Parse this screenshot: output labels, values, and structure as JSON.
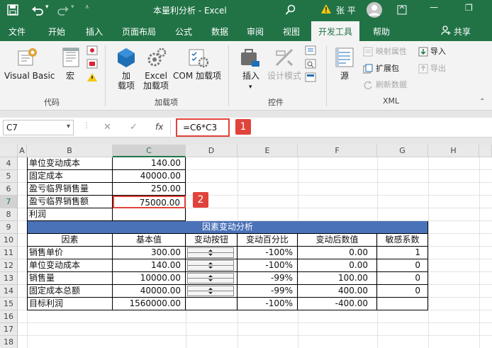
{
  "titlebar": {
    "title": "本量利分析 - Excel",
    "user": "张 平",
    "minimize": "—",
    "restore": "❐"
  },
  "tabs": [
    "文件",
    "开始",
    "插入",
    "页面布局",
    "公式",
    "数据",
    "审阅",
    "视图",
    "开发工具",
    "帮助"
  ],
  "share": "共享",
  "ribbon": {
    "code": {
      "visual_basic": "Visual Basic",
      "macro": "宏",
      "group": "代码"
    },
    "addins": {
      "addin": "加\n载项",
      "excel_addin": "Excel\n加载项",
      "com_addin": "COM 加载项",
      "group": "加载项"
    },
    "controls": {
      "insert": "插入",
      "design_mode": "设计模式",
      "group": "控件"
    },
    "xml": {
      "source": "源",
      "map_props": "映射属性",
      "expand_packs": "扩展包",
      "refresh_data": "刷新数据",
      "import": "导入",
      "export": "导出",
      "group": "XML"
    }
  },
  "formula": {
    "namebox": "C7",
    "cancel": "✕",
    "enter": "✓",
    "fx": "fx",
    "value": "=C6*C3"
  },
  "callouts": [
    "1",
    "2"
  ],
  "columns": [
    "A",
    "B",
    "C",
    "D",
    "E",
    "F",
    "G",
    "H"
  ],
  "rows": [
    "4",
    "5",
    "6",
    "7",
    "8",
    "9",
    "10",
    "11",
    "12",
    "13",
    "14",
    "15",
    "16",
    "17",
    "18"
  ],
  "top_table": [
    {
      "label": "单位变动成本",
      "value": "140.00"
    },
    {
      "label": "固定成本",
      "value": "40000.00"
    },
    {
      "label": "盈亏临界销售量",
      "value": "250.00"
    },
    {
      "label": "盈亏临界销售额",
      "value": "75000.00"
    },
    {
      "label": "利润",
      "value": ""
    }
  ],
  "analysis": {
    "title": "因素变动分析",
    "headers": [
      "因素",
      "基本值",
      "变动按钮",
      "变动百分比",
      "变动后数值",
      "敏感系数"
    ],
    "rows": [
      {
        "factor": "销售单价",
        "base": "300.00",
        "pct": "-100%",
        "after": "0.00",
        "sens": "1"
      },
      {
        "factor": "单位变动成本",
        "base": "140.00",
        "pct": "-100%",
        "after": "0.00",
        "sens": "0"
      },
      {
        "factor": "销售量",
        "base": "10000.00",
        "pct": "-99%",
        "after": "100.00",
        "sens": "0"
      },
      {
        "factor": "固定成本总额",
        "base": "40000.00",
        "pct": "-99%",
        "after": "400.00",
        "sens": "0"
      },
      {
        "factor": "目标利润",
        "base": "1560000.00",
        "pct": "-100%",
        "after": "-400.00",
        "sens": ""
      }
    ]
  },
  "colors": {
    "excel_green": "#217346",
    "header_blue": "#4a72b8",
    "callout_red": "#e0433b",
    "highlight_red": "#e0433b"
  }
}
